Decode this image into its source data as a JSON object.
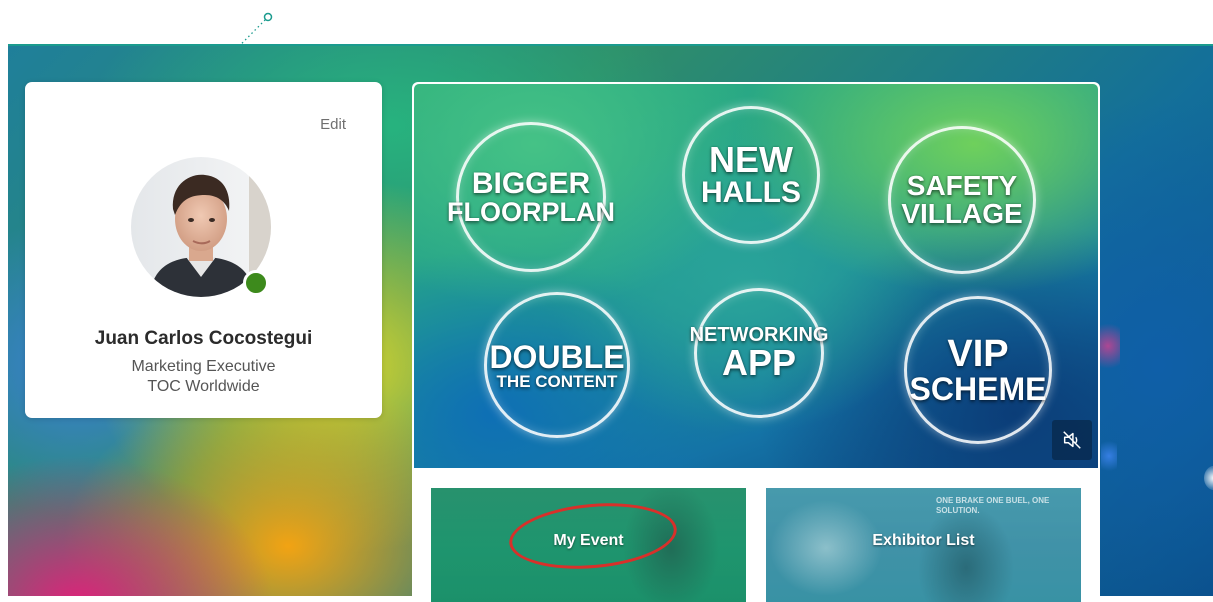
{
  "profile": {
    "edit_label": "Edit",
    "name": "Juan Carlos Cocostegui",
    "title": "Marketing Executive",
    "company": "TOC Worldwide",
    "status_color": "#3d8a1c"
  },
  "promo_video": {
    "bubbles": [
      {
        "lines": [
          "BIGGER",
          "FLOORPLAN"
        ]
      },
      {
        "lines": [
          "NEW",
          "HALLS"
        ]
      },
      {
        "lines": [
          "SAFETY",
          "VILLAGE"
        ]
      },
      {
        "lines": [
          "DOUBLE",
          "THE CONTENT"
        ]
      },
      {
        "lines": [
          "NETWORKING",
          "APP"
        ]
      },
      {
        "lines": [
          "VIP",
          "SCHEME"
        ]
      }
    ],
    "mute_icon": "volume-muted-icon"
  },
  "tiles": {
    "my_event": "My Event",
    "exhibitor_list": "Exhibitor List",
    "exhibitor_sign": "ONE BRAKE ONE BUEL, ONE SOLUTION."
  },
  "annotation": {
    "highlight_color": "#d8302a",
    "pointer_color": "#1a9b8e"
  }
}
